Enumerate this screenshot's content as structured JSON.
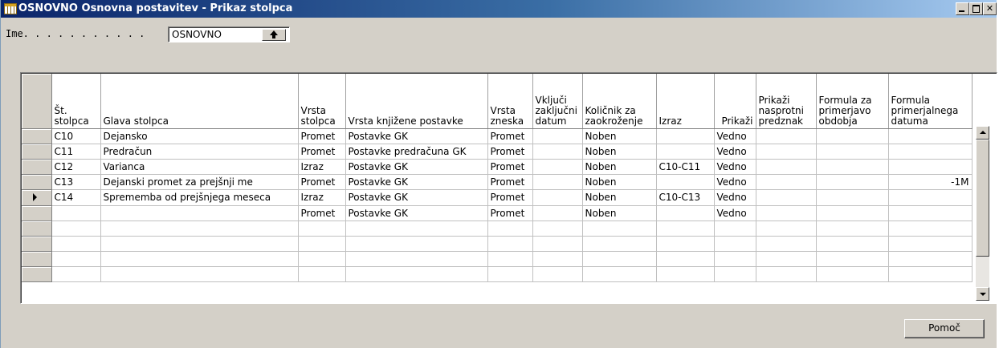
{
  "window": {
    "title": "OSNOVNO Osnovna postavitev - Prikaz stolpca",
    "icon": "table-icon"
  },
  "name_field": {
    "label": "Ime. . . . . . . . . . .",
    "value": "OSNOVNO"
  },
  "grid": {
    "columns": [
      "Št. stolpca",
      "Glava stolpca",
      "Vrsta stolpca",
      "Vrsta knjižene postavke",
      "Vrsta zneska",
      "Vključi zaključni datum",
      "Količnik za zaokroženje",
      "Izraz",
      "Prikaži",
      "Prikaži nasprotni predznak",
      "Formula za primerjavo obdobja",
      "Formula primerjalnega datuma"
    ],
    "rows": [
      [
        "C10",
        "Dejansko",
        "Promet",
        "Postavke GK",
        "Promet",
        "",
        "Noben",
        "",
        "Vedno",
        "",
        "",
        ""
      ],
      [
        "C11",
        "Predračun",
        "Promet",
        "Postavke predračuna GK",
        "Promet",
        "",
        "Noben",
        "",
        "Vedno",
        "",
        "",
        ""
      ],
      [
        "C12",
        "Varianca",
        "Izraz",
        "Postavke GK",
        "Promet",
        "",
        "Noben",
        "C10-C11",
        "Vedno",
        "",
        "",
        ""
      ],
      [
        "C13",
        "Dejanski promet za prejšnji me",
        "Promet",
        "Postavke GK",
        "Promet",
        "",
        "Noben",
        "",
        "Vedno",
        "",
        "",
        "-1M"
      ],
      [
        "C14",
        "Sprememba od prejšnjega meseca",
        "Izraz",
        "Postavke GK",
        "Promet",
        "",
        "Noben",
        "C10-C13",
        "Vedno",
        "",
        "",
        ""
      ],
      [
        "",
        "",
        "Promet",
        "Postavke GK",
        "Promet",
        "",
        "Noben",
        "",
        "Vedno",
        "",
        "",
        ""
      ],
      [
        "",
        "",
        "",
        "",
        "",
        "",
        "",
        "",
        "",
        "",
        "",
        ""
      ],
      [
        "",
        "",
        "",
        "",
        "",
        "",
        "",
        "",
        "",
        "",
        "",
        ""
      ],
      [
        "",
        "",
        "",
        "",
        "",
        "",
        "",
        "",
        "",
        "",
        "",
        ""
      ],
      [
        "",
        "",
        "",
        "",
        "",
        "",
        "",
        "",
        "",
        "",
        "",
        ""
      ]
    ],
    "selected_row": 4
  },
  "buttons": {
    "help": "Pomoč"
  }
}
